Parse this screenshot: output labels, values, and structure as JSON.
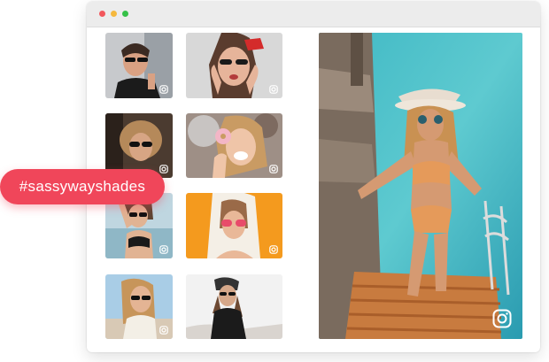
{
  "window": {
    "controls": [
      "close",
      "minimize",
      "maximize"
    ]
  },
  "hashtag": {
    "text": "#sassywayshades",
    "color": "#f0465a"
  },
  "gallery": {
    "thumbnails": [
      {
        "name": "woman-black-top-sunglasses",
        "icon": "instagram-icon"
      },
      {
        "name": "woman-red-headband-sunglasses",
        "icon": "instagram-icon"
      },
      {
        "name": "woman-curly-hair-sunglasses",
        "icon": "instagram-icon"
      },
      {
        "name": "woman-laughing-donut",
        "icon": "instagram-icon"
      },
      {
        "name": "woman-pink-sunglasses-beach",
        "icon": "instagram-icon"
      },
      {
        "name": "woman-orange-background",
        "icon": "instagram-icon"
      },
      {
        "name": "woman-braids-sunglasses",
        "icon": "instagram-icon"
      },
      {
        "name": "woman-beanie-sunglasses",
        "icon": "instagram-icon"
      }
    ],
    "featured": {
      "name": "woman-swimsuit-hat-dock",
      "icon": "instagram-icon"
    }
  }
}
